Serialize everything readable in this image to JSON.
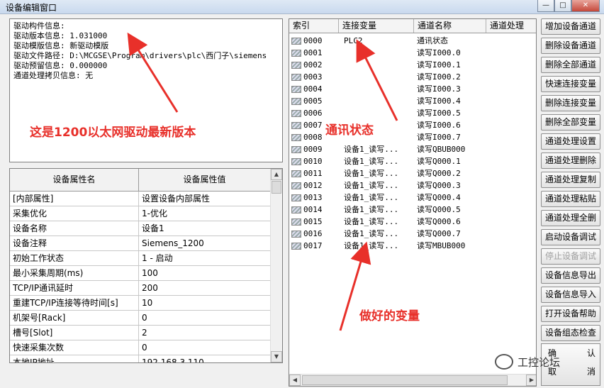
{
  "window": {
    "title": "设备编辑窗口",
    "buttons": [
      "—",
      "□",
      "✕"
    ]
  },
  "info": {
    "lines": [
      "驱动构件信息:",
      "驱动版本信息: 1.031000",
      "驱动模版信息: 新驱动模版",
      "驱动文件路径: D:\\MCGSE\\Program\\drivers\\plc\\西门子\\siemens",
      "驱动预留信息: 0.000000",
      "通道处理拷贝信息: 无"
    ]
  },
  "annotations": {
    "driver_note": "这是1200以太网驱动最新版本",
    "comm_status_note": "通讯状态",
    "variables_note": "做好的变量"
  },
  "props": {
    "headers": [
      "设备属性名",
      "设备属性值"
    ],
    "rows": [
      [
        "[内部属性]",
        "设置设备内部属性"
      ],
      [
        "采集优化",
        "1-优化"
      ],
      [
        "设备名称",
        "设备1"
      ],
      [
        "设备注释",
        "Siemens_1200"
      ],
      [
        "初始工作状态",
        "1 - 启动"
      ],
      [
        "最小采集周期(ms)",
        "100"
      ],
      [
        "TCP/IP通讯延时",
        "200"
      ],
      [
        "重建TCP/IP连接等待时间[s]",
        "10"
      ],
      [
        "机架号[Rack]",
        "0"
      ],
      [
        "槽号[Slot]",
        "2"
      ],
      [
        "快速采集次数",
        "0"
      ],
      [
        "本地IP地址",
        "192.168.3.110"
      ]
    ]
  },
  "vars": {
    "headers": [
      "索引",
      "连接变量",
      "通道名称",
      "通道处理"
    ],
    "rows": [
      [
        "0000",
        "PLC2",
        "通讯状态"
      ],
      [
        "0001",
        "",
        "读写I000.0"
      ],
      [
        "0002",
        "",
        "读写I000.1"
      ],
      [
        "0003",
        "",
        "读写I000.2"
      ],
      [
        "0004",
        "",
        "读写I000.3"
      ],
      [
        "0005",
        "",
        "读写I000.4"
      ],
      [
        "0006",
        "",
        "读写I000.5"
      ],
      [
        "0007",
        "",
        "读写I000.6"
      ],
      [
        "0008",
        "",
        "读写I000.7"
      ],
      [
        "0009",
        "设备1_读写...",
        "读写QBUB000"
      ],
      [
        "0010",
        "设备1_读写...",
        "读写Q000.1"
      ],
      [
        "0011",
        "设备1_读写...",
        "读写Q000.2"
      ],
      [
        "0012",
        "设备1_读写...",
        "读写Q000.3"
      ],
      [
        "0013",
        "设备1_读写...",
        "读写Q000.4"
      ],
      [
        "0014",
        "设备1_读写...",
        "读写Q000.5"
      ],
      [
        "0015",
        "设备1_读写...",
        "读写Q000.6"
      ],
      [
        "0016",
        "设备1_读写...",
        "读写Q000.7"
      ],
      [
        "0017",
        "设备1_读写...",
        "读写MBUB000"
      ]
    ]
  },
  "actions": [
    {
      "label": "增加设备通道",
      "enabled": true
    },
    {
      "label": "删除设备通道",
      "enabled": true
    },
    {
      "label": "删除全部通道",
      "enabled": true
    },
    {
      "label": "快速连接变量",
      "enabled": true
    },
    {
      "label": "删除连接变量",
      "enabled": true
    },
    {
      "label": "删除全部变量",
      "enabled": true
    },
    {
      "label": "通道处理设置",
      "enabled": true
    },
    {
      "label": "通道处理删除",
      "enabled": true
    },
    {
      "label": "通道处理复制",
      "enabled": true
    },
    {
      "label": "通道处理粘贴",
      "enabled": true
    },
    {
      "label": "通道处理全删",
      "enabled": true
    },
    {
      "label": "启动设备调试",
      "enabled": true
    },
    {
      "label": "停止设备调试",
      "enabled": false
    },
    {
      "label": "设备信息导出",
      "enabled": true
    },
    {
      "label": "设备信息导入",
      "enabled": true
    },
    {
      "label": "打开设备帮助",
      "enabled": true
    },
    {
      "label": "设备组态检查",
      "enabled": true
    }
  ],
  "okcancel": {
    "ok1": "确",
    "ok2": "认",
    "cancel1": "取",
    "cancel2": "消"
  },
  "watermark": "工控论坛",
  "colors": {
    "annotation": "#e8302a"
  }
}
